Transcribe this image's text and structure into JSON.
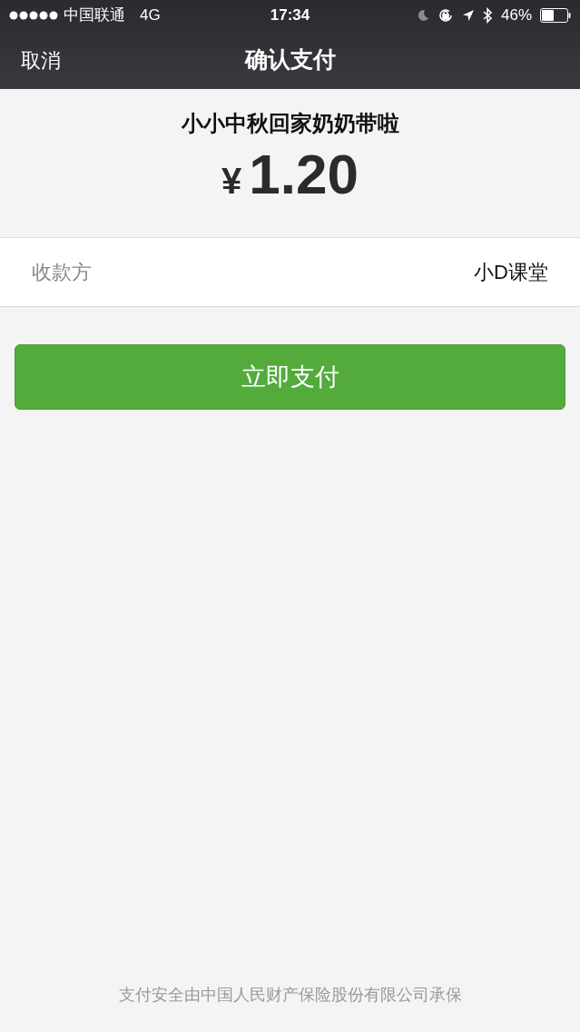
{
  "status_bar": {
    "carrier": "中国联通",
    "network": "4G",
    "time": "17:34",
    "battery": "46%"
  },
  "nav_bar": {
    "cancel": "取消",
    "title": "确认支付"
  },
  "order": {
    "name": "小小中秋回家奶奶带啦",
    "currency": "¥",
    "amount": "1.20"
  },
  "payee": {
    "label": "收款方",
    "value": "小D课堂"
  },
  "pay_button": "立即支付",
  "footer": "支付安全由中国人民财产保险股份有限公司承保"
}
